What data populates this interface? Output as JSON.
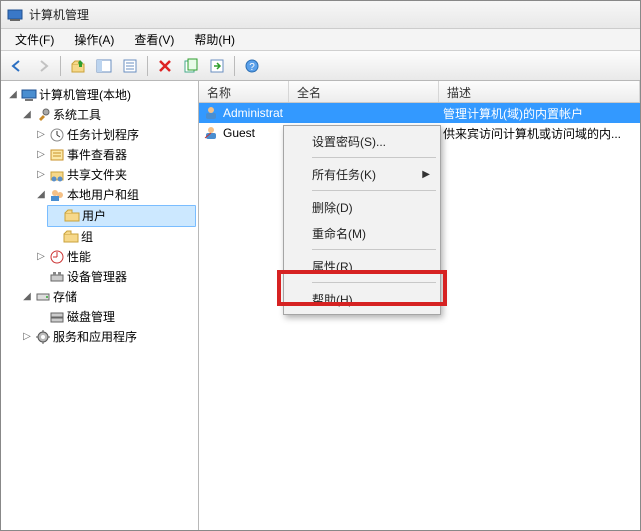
{
  "window": {
    "title": "计算机管理"
  },
  "menubar": {
    "file": "文件(F)",
    "action": "操作(A)",
    "view": "查看(V)",
    "help": "帮助(H)"
  },
  "tree": {
    "root": "计算机管理(本地)",
    "system_tools": "系统工具",
    "task_scheduler": "任务计划程序",
    "event_viewer": "事件查看器",
    "shared_folders": "共享文件夹",
    "local_users_groups": "本地用户和组",
    "users": "用户",
    "groups": "组",
    "performance": "性能",
    "device_manager": "设备管理器",
    "storage": "存储",
    "disk_management": "磁盘管理",
    "services_apps": "服务和应用程序"
  },
  "list": {
    "cols": {
      "name": "名称",
      "full": "全名",
      "desc": "描述"
    },
    "rows": [
      {
        "name": "Administrat",
        "full": "",
        "desc": "管理计算机(域)的内置帐户",
        "selected": true
      },
      {
        "name": "Guest",
        "full": "",
        "desc": "供来宾访问计算机或访问域的内...",
        "selected": false
      }
    ]
  },
  "context_menu": {
    "set_password": "设置密码(S)...",
    "all_tasks": "所有任务(K)",
    "delete": "删除(D)",
    "rename": "重命名(M)",
    "properties": "属性(R)",
    "help": "帮助(H)"
  }
}
